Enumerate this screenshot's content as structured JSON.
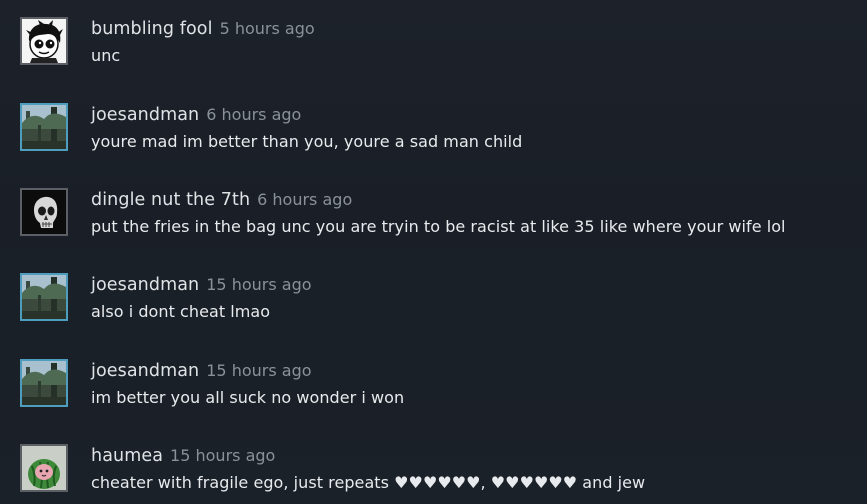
{
  "comments": [
    {
      "author": "bumbling fool",
      "time": "5 hours ago",
      "text": "unc",
      "avatar_icon": "cartoon-kid-avatar"
    },
    {
      "author": "joesandman",
      "time": "6 hours ago",
      "text": "youre mad im better than you, youre a sad man child",
      "avatar_icon": "forest-scene-avatar"
    },
    {
      "author": "dingle nut the 7th",
      "time": "6 hours ago",
      "text": "put the fries in the bag unc you are tryin to be racist at like 35 like where your wife lol",
      "avatar_icon": "skull-avatar"
    },
    {
      "author": "joesandman",
      "time": "15 hours ago",
      "text": "also i dont cheat lmao",
      "avatar_icon": "forest-scene-avatar"
    },
    {
      "author": "joesandman",
      "time": "15 hours ago",
      "text": "im better you all suck no wonder i won",
      "avatar_icon": "forest-scene-avatar"
    },
    {
      "author": "haumea",
      "time": "15 hours ago",
      "text": "cheater with fragile ego, just repeats ♥♥♥♥♥♥, ♥♥♥♥♥♥ and jew",
      "avatar_icon": "watermelon-cat-avatar"
    }
  ],
  "colors": {
    "background": "#1b2129",
    "author": "#dfe3e6",
    "timestamp": "#8a9199",
    "text": "#e8ebed",
    "online_border": "#4e9dbd",
    "offline_border": "#5c6066"
  }
}
